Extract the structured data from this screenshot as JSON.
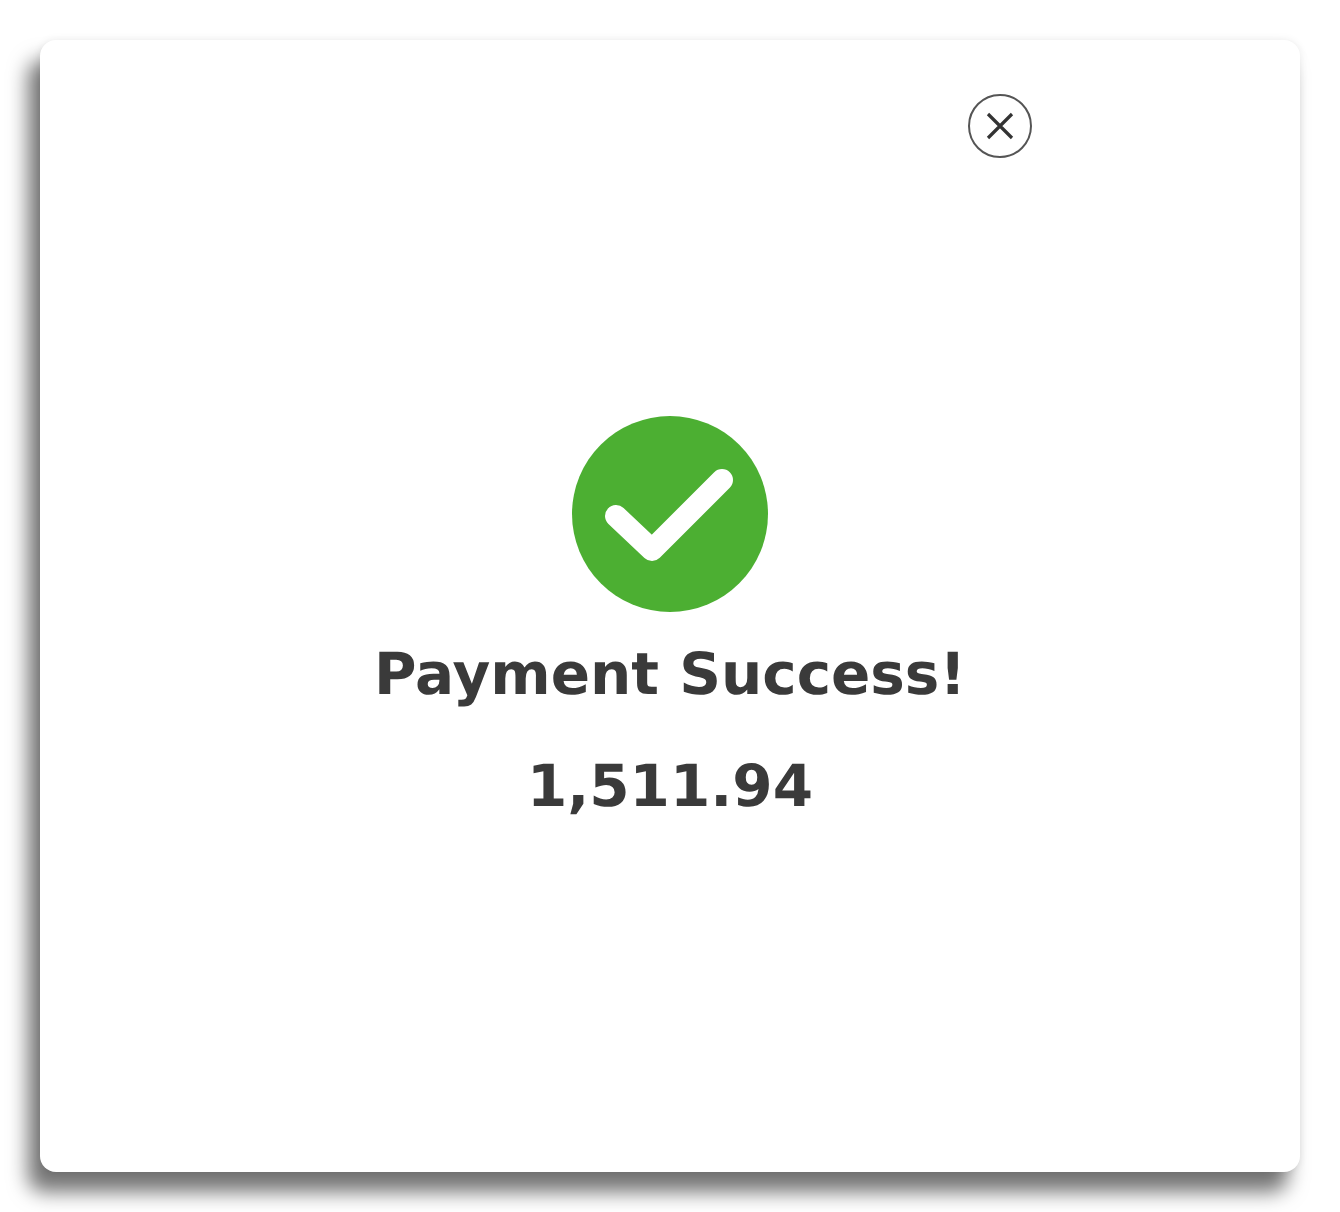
{
  "dialog": {
    "title": "Payment Success!",
    "amount": "1,511.94",
    "success": true
  }
}
